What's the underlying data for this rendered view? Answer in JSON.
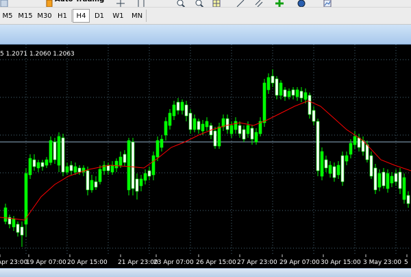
{
  "toolbar": {
    "autotrading_label": "Auto Trading"
  },
  "timeframes": [
    "M5",
    "M15",
    "M30",
    "H1",
    "H4",
    "D1",
    "W1",
    "MN"
  ],
  "active_timeframe": "H4",
  "chart": {
    "symbol_info": "5 1.2071 1.2060 1.2063",
    "x_labels": [
      "Apr 23:00",
      "19 Apr 07:00",
      "20 Apr 15:00",
      "21 Apr 23:00",
      "23 Apr 07:00",
      "26 Apr 15:00",
      "27 Apr 23:00",
      "29 Apr 07:00",
      "30 Apr 15:00",
      "3 May 23:00",
      "5"
    ],
    "colors": {
      "background": "#000000",
      "grid": "#4a6a7a",
      "bull": "#00ff00",
      "bear_fill": "#ffffff",
      "ma": "#ff0000",
      "level": "#8fb0c8"
    }
  }
}
